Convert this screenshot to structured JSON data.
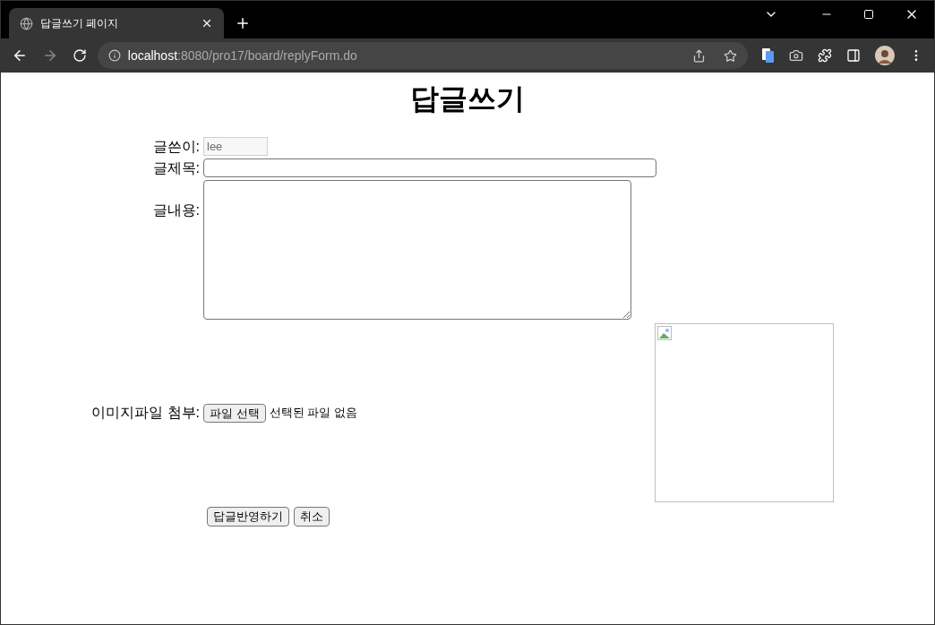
{
  "browser": {
    "tab_title": "답글쓰기 페이지",
    "url_host": "localhost",
    "url_rest": ":8080/pro17/board/replyForm.do"
  },
  "heading": "답글쓰기",
  "form": {
    "author": {
      "label": "글쓴이:",
      "value": "lee",
      "disabled": true
    },
    "title": {
      "label": "글제목:"
    },
    "content": {
      "label": "글내용:"
    },
    "image": {
      "label": "이미지파일 첨부:",
      "button": "파일 선택",
      "status": "선택된 파일 없음"
    },
    "buttons": [
      "답글반영하기",
      "취소"
    ]
  }
}
